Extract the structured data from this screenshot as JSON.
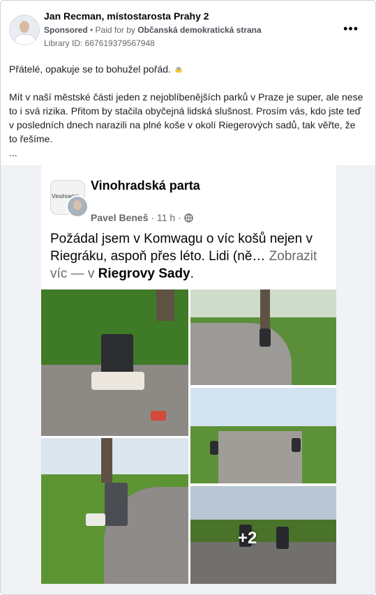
{
  "ad": {
    "author_name": "Jan Recman, místostarosta Prahy 2",
    "sponsored_label": "Sponsored",
    "paid_for_label": "Paid for by",
    "payer": "Občanská demokratická strana",
    "library_id": "Library ID: 667619379567948",
    "more_icon": "more-horizontal-icon",
    "more_symbol": "•••",
    "text_line1": "Přátelé, opakuje se to bohužel pořád.",
    "text_line2": "Mít v naší městské části jeden z nejoblíbenějších parků v Praze je super, ale nese to i svá rizika. Přitom by stačila obyčejná lidská slušnost. Prosím vás, kdo jste teď v posledních dnech narazili na plné koše v okolí Riegerových sadů, tak věřte, že to řešíme.",
    "text_ellipsis": "..."
  },
  "shared_post": {
    "group_avatar_text": "Vinohradsk",
    "group_name": "Vinohradská parta",
    "author": "Pavel Beneš",
    "time": "11 h",
    "separator": "·",
    "globe_icon": "globe-icon",
    "text_main": "Požádal jsem v Komwagu o víc košů nejen v Riegráku, aspoň přes léto. Lidi (ně…",
    "see_more": "Zobrazit víc",
    "location_prefix": "— v",
    "location": "Riegrovy Sady",
    "location_suffix": ".",
    "more_photos": "+2"
  },
  "colors": {
    "page_bg": "#ffffff",
    "muted_text": "#65676b",
    "grass": "#4f8b31",
    "path": "#9a9a98",
    "sky": "#d9e7f2"
  }
}
